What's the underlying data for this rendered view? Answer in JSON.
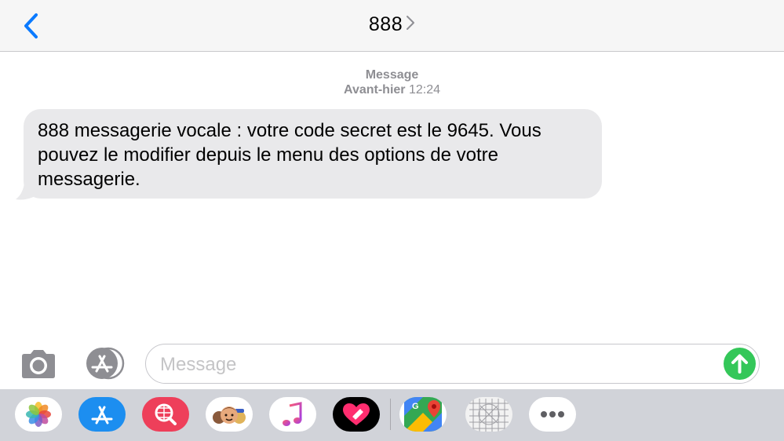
{
  "header": {
    "contact_name": "888",
    "back_icon": "chevron-left-icon",
    "chevron_icon": "chevron-right-icon"
  },
  "conversation": {
    "service_label": "Message",
    "day_label": "Avant-hier",
    "time": "12:24",
    "messages": [
      {
        "direction": "incoming",
        "text": "888 messagerie vocale : votre code secret est le 9645. Vous pouvez le modifier depuis le menu des options de votre messagerie."
      }
    ]
  },
  "composer": {
    "placeholder": "Message",
    "value": "",
    "camera_icon": "camera-icon",
    "apps_icon": "app-store-icon",
    "send_icon": "send-arrow-icon"
  },
  "app_drawer": {
    "apps": [
      {
        "name": "Photos",
        "icon": "photos-icon"
      },
      {
        "name": "App Store",
        "icon": "app-store-icon"
      },
      {
        "name": "Images search",
        "icon": "globe-search-icon"
      },
      {
        "name": "Memoji",
        "icon": "memoji-icon"
      },
      {
        "name": "Music",
        "icon": "music-note-icon"
      },
      {
        "name": "Digital Touch",
        "icon": "heart-icon"
      },
      {
        "name": "Google Maps",
        "icon": "maps-icon"
      },
      {
        "name": "Grid app",
        "icon": "grid-icon"
      },
      {
        "name": "More",
        "icon": "more-dots-icon"
      }
    ]
  },
  "colors": {
    "accent_blue": "#0a7aff",
    "bubble_incoming": "#e9e9eb",
    "send_green": "#34c759",
    "meta_gray": "#8e8e93",
    "drawer_bg": "#d1d3d9"
  }
}
